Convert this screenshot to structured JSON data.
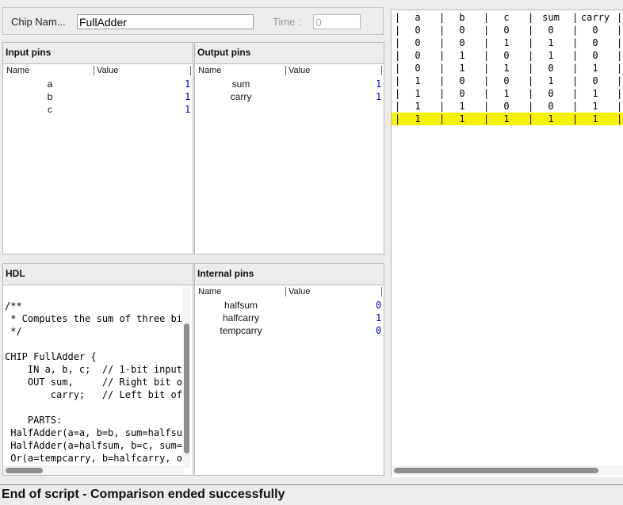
{
  "chip": {
    "name_label": "Chip Nam...",
    "name_value": "FullAdder",
    "time_label": "Time :",
    "time_value": "0"
  },
  "input_pins": {
    "title": "Input pins",
    "col_name": "Name",
    "col_value": "Value",
    "rows": [
      {
        "name": "a",
        "value": "1"
      },
      {
        "name": "b",
        "value": "1"
      },
      {
        "name": "c",
        "value": "1"
      }
    ]
  },
  "output_pins": {
    "title": "Output pins",
    "col_name": "Name",
    "col_value": "Value",
    "rows": [
      {
        "name": "sum",
        "value": "1"
      },
      {
        "name": "carry",
        "value": "1"
      }
    ]
  },
  "hdl": {
    "title": "HDL",
    "code": "/**\n * Computes the sum of three bit\n */\n\nCHIP FullAdder {\n    IN a, b, c;  // 1-bit inputs\n    OUT sum,     // Right bit of\n        carry;   // Left bit of\n\n    PARTS:\n HalfAdder(a=a, b=b, sum=halfsum\n HalfAdder(a=halfsum, b=c, sum=s\n Or(a=tempcarry, b=halfcarry, ou"
  },
  "internal_pins": {
    "title": "Internal pins",
    "col_name": "Name",
    "col_value": "Value",
    "rows": [
      {
        "name": "halfsum",
        "value": "0"
      },
      {
        "name": "halfcarry",
        "value": "1"
      },
      {
        "name": "tempcarry",
        "value": "0"
      }
    ]
  },
  "truth_table": {
    "headers": [
      "a",
      "b",
      "c",
      "sum",
      "carry"
    ],
    "rows": [
      [
        "0",
        "0",
        "0",
        "0",
        "0"
      ],
      [
        "0",
        "0",
        "1",
        "1",
        "0"
      ],
      [
        "0",
        "1",
        "0",
        "1",
        "0"
      ],
      [
        "0",
        "1",
        "1",
        "0",
        "1"
      ],
      [
        "1",
        "0",
        "0",
        "1",
        "0"
      ],
      [
        "1",
        "0",
        "1",
        "0",
        "1"
      ],
      [
        "1",
        "1",
        "0",
        "0",
        "1"
      ],
      [
        "1",
        "1",
        "1",
        "1",
        "1"
      ]
    ],
    "highlighted_row": 7,
    "highlight_color": "#f7f200"
  },
  "status": {
    "text": "End of script - Comparison ended successfully"
  }
}
